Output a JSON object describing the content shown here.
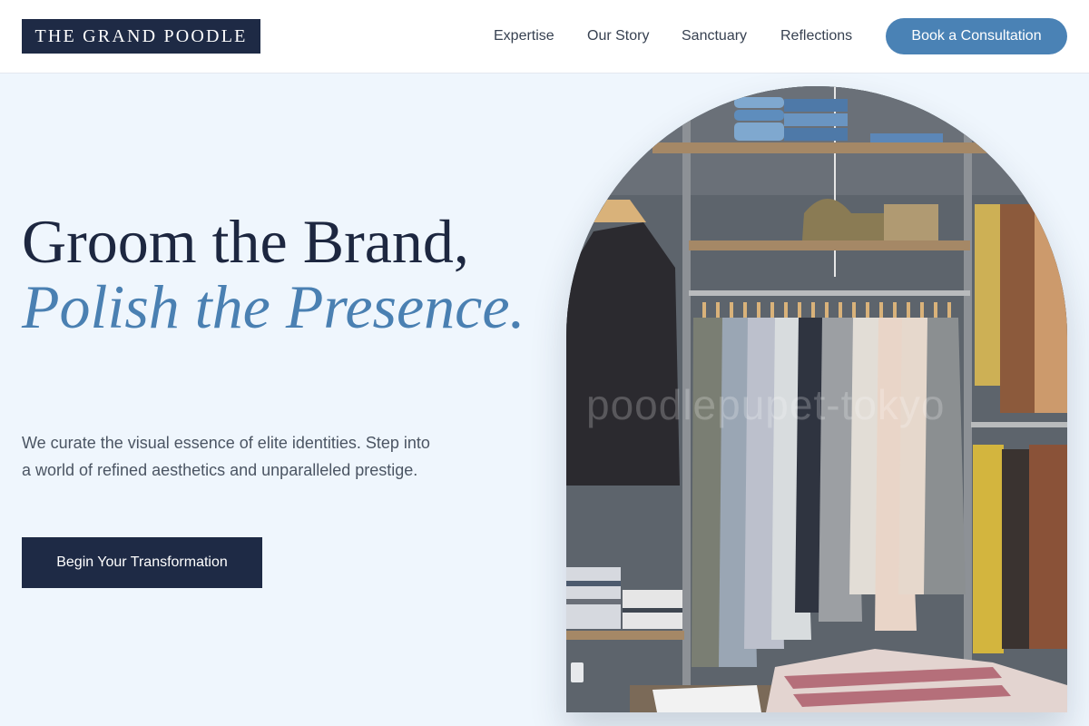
{
  "header": {
    "logo": "THE GRAND POODLE",
    "nav": [
      "Expertise",
      "Our Story",
      "Sanctuary",
      "Reflections"
    ],
    "cta": "Book a Consultation"
  },
  "hero": {
    "headline_line1": "Groom the Brand,",
    "headline_accent": "Polish the Presence.",
    "subtext": "We curate the visual essence of elite identities. Step into a world of refined aesthetics and unparalleled prestige.",
    "cta": "Begin Your Transformation",
    "image_watermark": "poodlepupet-tokyo"
  },
  "colors": {
    "page_background": "#eff6fd",
    "navy": "#1e2a45",
    "accent_blue": "#4a82b5",
    "text_gray": "#4b5563"
  }
}
